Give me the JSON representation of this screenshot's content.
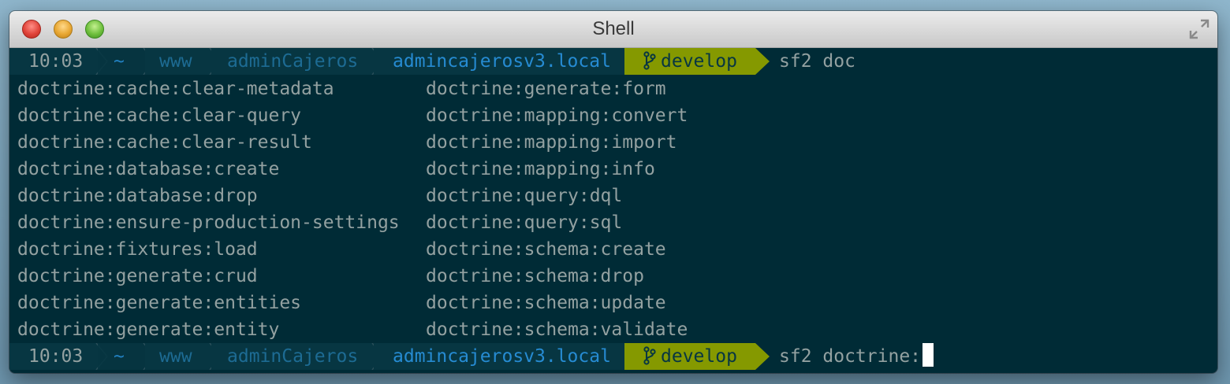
{
  "window": {
    "title": "Shell",
    "icons": {
      "close": "close-icon",
      "minimize": "minimize-icon",
      "zoom": "zoom-icon",
      "fullscreen": "fullscreen-icon",
      "branch": "git-branch-icon"
    }
  },
  "prompt": {
    "time": "10:03",
    "home": "~",
    "dir1": "www",
    "dir2": "adminCajeros",
    "dir3": "admincajerosv3.local",
    "branch": "develop",
    "colors": {
      "segment_bg": "#073642",
      "branch_bg": "#859900",
      "path_blue": "#268bd2",
      "text": "#93a1a1"
    }
  },
  "lines": {
    "command1": "sf2 doc",
    "command2": "sf2 doctrine:"
  },
  "completions": {
    "col1": [
      "doctrine:cache:clear-metadata",
      "doctrine:cache:clear-query",
      "doctrine:cache:clear-result",
      "doctrine:database:create",
      "doctrine:database:drop",
      "doctrine:ensure-production-settings",
      "doctrine:fixtures:load",
      "doctrine:generate:crud",
      "doctrine:generate:entities",
      "doctrine:generate:entity"
    ],
    "col2": [
      "doctrine:generate:form",
      "doctrine:mapping:convert",
      "doctrine:mapping:import",
      "doctrine:mapping:info",
      "doctrine:query:dql",
      "doctrine:query:sql",
      "doctrine:schema:create",
      "doctrine:schema:drop",
      "doctrine:schema:update",
      "doctrine:schema:validate"
    ]
  }
}
